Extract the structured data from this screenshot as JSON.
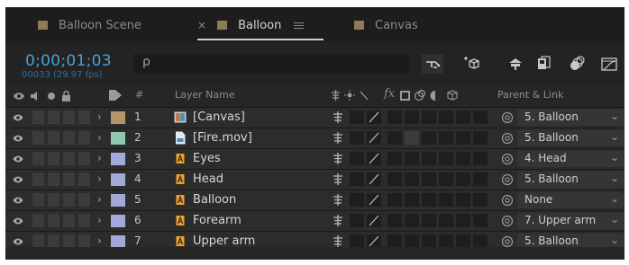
{
  "tabs": [
    {
      "label": "Balloon Scene",
      "active": false,
      "swatch": "#8f7a56"
    },
    {
      "label": "Balloon",
      "active": true,
      "swatch": "#8f7a56"
    },
    {
      "label": "Canvas",
      "active": false,
      "swatch": "#8f7a56"
    }
  ],
  "tab_close_glyph": "×",
  "timecode": "0;00;01;03",
  "frame_info": "00033 (29.97 fps)",
  "search": {
    "glyph": "ρ",
    "placeholder": ""
  },
  "header_icons": [
    "composition-flowchart-icon",
    "draft-3d-icon",
    "shy-layers-icon",
    "frame-blending-icon",
    "motion-blur-icon",
    "graph-editor-icon"
  ],
  "columns": {
    "layer_name": "Layer Name",
    "switches_fx": "fx",
    "parent_link": "Parent & Link",
    "label_hash": "#"
  },
  "layers": [
    {
      "num": "1",
      "name": "[Canvas]",
      "label_color": "#b4966b",
      "type": "comp",
      "parent": "5. Balloon",
      "selected": true
    },
    {
      "num": "2",
      "name": "[Fire.mov]",
      "label_color": "#8fc7b0",
      "type": "file",
      "parent": "5. Balloon"
    },
    {
      "num": "3",
      "name": "Eyes",
      "label_color": "#a2a9d8",
      "type": "ai",
      "parent": "4. Head"
    },
    {
      "num": "4",
      "name": "Head",
      "label_color": "#a2a9d8",
      "type": "ai",
      "parent": "5. Balloon"
    },
    {
      "num": "5",
      "name": "Balloon",
      "label_color": "#a2a9d8",
      "type": "ai",
      "parent": "None"
    },
    {
      "num": "6",
      "name": "Forearm",
      "label_color": "#a2a9d8",
      "type": "ai",
      "parent": "7. Upper arm"
    },
    {
      "num": "7",
      "name": "Upper arm",
      "label_color": "#a2a9d8",
      "type": "ai",
      "parent": "5. Balloon"
    }
  ],
  "glyphs": {
    "expand": "›",
    "dropdown": "⌄"
  }
}
